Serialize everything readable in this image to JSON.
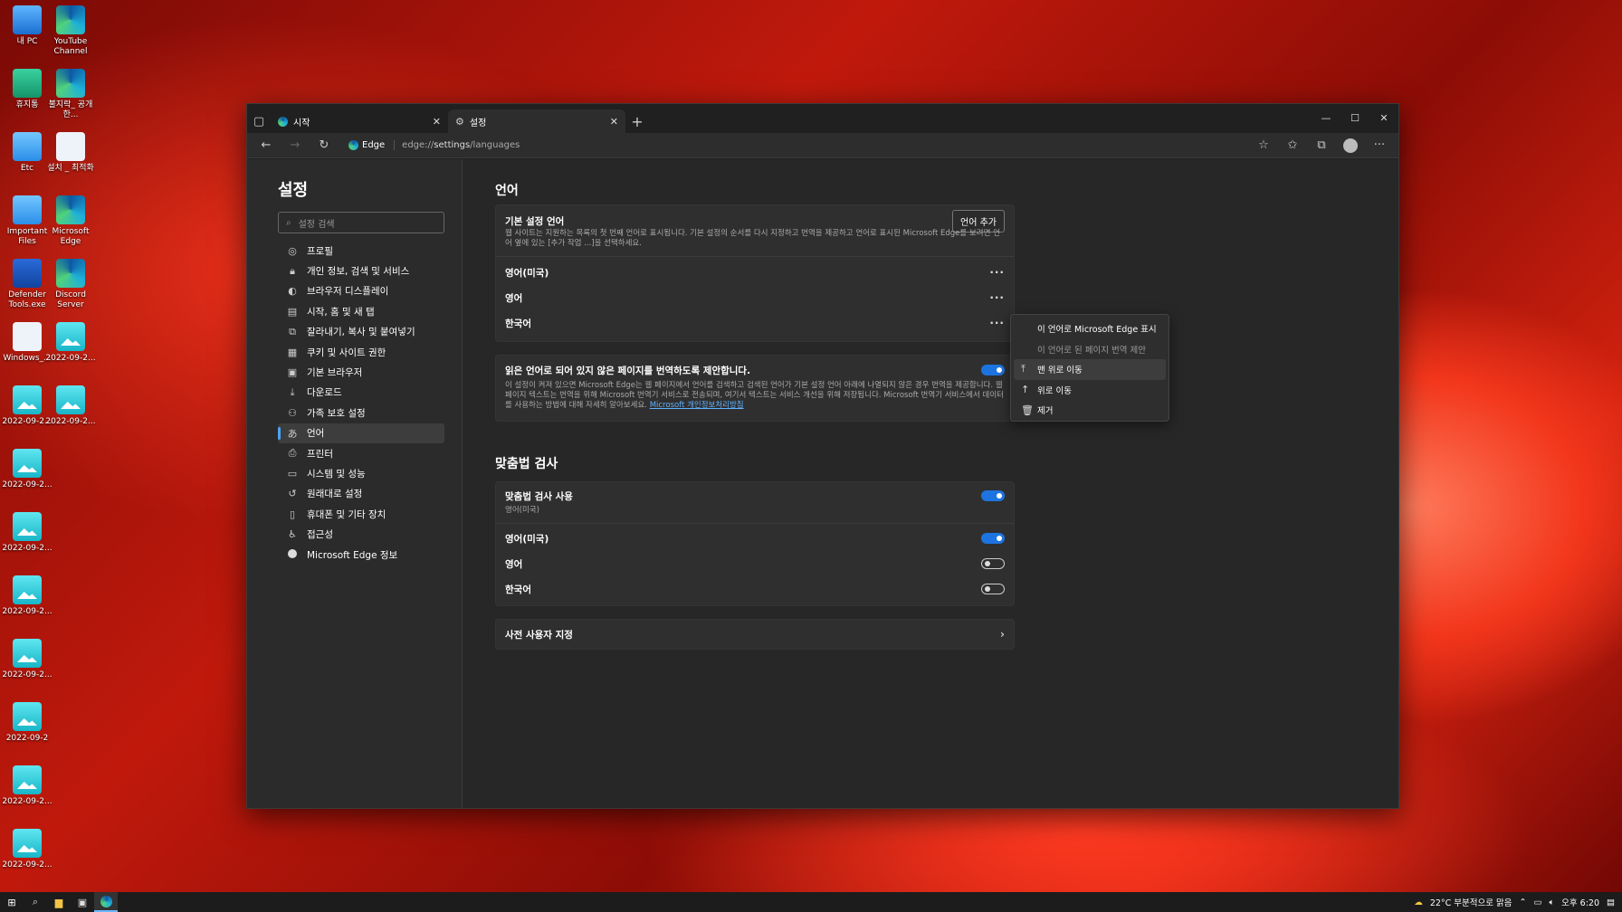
{
  "desktop": {
    "icons": [
      {
        "label": "내 PC",
        "icon": "pc-icon"
      },
      {
        "label": "YouTube Channel",
        "icon": "edge-icon"
      },
      {
        "label": "휴지통",
        "icon": "recycle-bin-icon"
      },
      {
        "label": "불지락_ 공개한...",
        "icon": "edge-icon"
      },
      {
        "label": "Etc",
        "icon": "folder-icon"
      },
      {
        "label": "설치 _ 최적화",
        "icon": "gear-icon"
      },
      {
        "label": "Important Files",
        "icon": "folder-icon"
      },
      {
        "label": "Microsoft Edge",
        "icon": "edge-icon"
      },
      {
        "label": "Defender Tools.exe",
        "icon": "defender-icon"
      },
      {
        "label": "Discord Server",
        "icon": "edge-icon"
      },
      {
        "label": "Windows_...",
        "icon": "gear-icon"
      },
      {
        "label": "2022-09-2...",
        "icon": "image-icon"
      },
      {
        "label": "2022-09-2...",
        "icon": "image-icon"
      },
      {
        "label": "2022-09-2...",
        "icon": "image-icon"
      },
      {
        "label": "2022-09-2...",
        "icon": "image-icon"
      },
      {
        "label": "2022-09-2...",
        "icon": "image-icon"
      },
      {
        "label": "2022-09-2...",
        "icon": "image-icon"
      },
      {
        "label": "2022-09-2...",
        "icon": "image-icon"
      },
      {
        "label": "2022-09-2",
        "icon": "image-icon"
      },
      {
        "label": "2022-09-2...",
        "icon": "image-icon"
      },
      {
        "label": "2022-09-2...",
        "icon": "image-icon"
      }
    ]
  },
  "browser": {
    "tabs": [
      {
        "label": "시작"
      },
      {
        "label": "설정"
      }
    ],
    "address": {
      "site": "Edge",
      "url_prefix": "edge://",
      "url_bold": "settings",
      "url_suffix": "/languages"
    }
  },
  "sidebar": {
    "title": "설정",
    "search_placeholder": "설정 검색",
    "items": [
      {
        "label": "프로필",
        "icon": "profile-icon"
      },
      {
        "label": "개인 정보, 검색 및 서비스",
        "icon": "lock-icon"
      },
      {
        "label": "브라우저 디스플레이",
        "icon": "palette-icon"
      },
      {
        "label": "시작, 홈 및 새 탭",
        "icon": "home-icon"
      },
      {
        "label": "잘라내기, 복사 및 붙여넣기",
        "icon": "clipboard-icon"
      },
      {
        "label": "쿠키 및 사이트 권한",
        "icon": "cookie-icon"
      },
      {
        "label": "기본 브라우저",
        "icon": "browser-icon"
      },
      {
        "label": "다운로드",
        "icon": "download-icon"
      },
      {
        "label": "가족 보호 설정",
        "icon": "family-icon"
      },
      {
        "label": "언어",
        "icon": "language-icon"
      },
      {
        "label": "프린터",
        "icon": "printer-icon"
      },
      {
        "label": "시스템 및 성능",
        "icon": "system-icon"
      },
      {
        "label": "원래대로 설정",
        "icon": "reset-icon"
      },
      {
        "label": "휴대폰 및 기타 장치",
        "icon": "phone-icon"
      },
      {
        "label": "접근성",
        "icon": "accessibility-icon"
      },
      {
        "label": "Microsoft Edge 정보",
        "icon": "edge-icon"
      }
    ],
    "selected_index": 9
  },
  "languages": {
    "heading": "언어",
    "preferred_title": "기본 설정 언어",
    "preferred_desc": "웹 사이트는 지원하는 목록의 첫 번째 언어로 표시됩니다. 기본 설정의 순서를 다시 지정하고 번역을 제공하고 언어로 표시된 Microsoft Edge를 보려면 언어 옆에 있는 [추가 작업 ...]을 선택하세요.",
    "add_button": "언어 추가",
    "list": [
      "영어(미국)",
      "영어",
      "한국어"
    ],
    "translate_title": "읽은 언어로 되어 있지 않은 페이지를 번역하도록 제안합니다.",
    "translate_desc": "이 설정이 켜져 있으면 Microsoft Edge는 웹 페이지에서 언어를 검색하고 검색된 언어가 기본 설정 언어 아래에 나열되지 않은 경우 번역을 제공합니다. 웹 페이지 텍스트는 번역을 위해 Microsoft 번역기 서비스로 전송되며, 여기서 텍스트는 서비스 개선을 위해 저장됩니다. Microsoft 번역기 서비스에서 데이터를 사용하는 방법에 대해 자세히 알아보세요.",
    "translate_link": "Microsoft 개인정보처리방침",
    "translate_on": true
  },
  "spellcheck": {
    "heading": "맞춤법 검사",
    "enable_title": "맞춤법 검사 사용",
    "enable_sub": "영어(미국)",
    "enable_on": true,
    "langs": [
      {
        "label": "영어(미국)",
        "on": true
      },
      {
        "label": "영어",
        "on": false
      },
      {
        "label": "한국어",
        "on": false
      }
    ],
    "dictionary_title": "사전 사용자 지정"
  },
  "context_menu": {
    "items": [
      {
        "label": "이 언어로 Microsoft Edge 표시",
        "icon": "",
        "state": "normal"
      },
      {
        "label": "이 언어로 된 페이지 번역 제안",
        "icon": "",
        "state": "disabled"
      },
      {
        "label": "맨 위로 이동",
        "icon": "move-to-top-icon",
        "state": "highlight"
      },
      {
        "label": "위로 이동",
        "icon": "move-up-icon",
        "state": "normal"
      },
      {
        "label": "제거",
        "icon": "trash-icon",
        "state": "normal"
      }
    ]
  },
  "taskbar": {
    "weather": "22°C 부분적으로 맑음",
    "time": "오후 6:20"
  }
}
